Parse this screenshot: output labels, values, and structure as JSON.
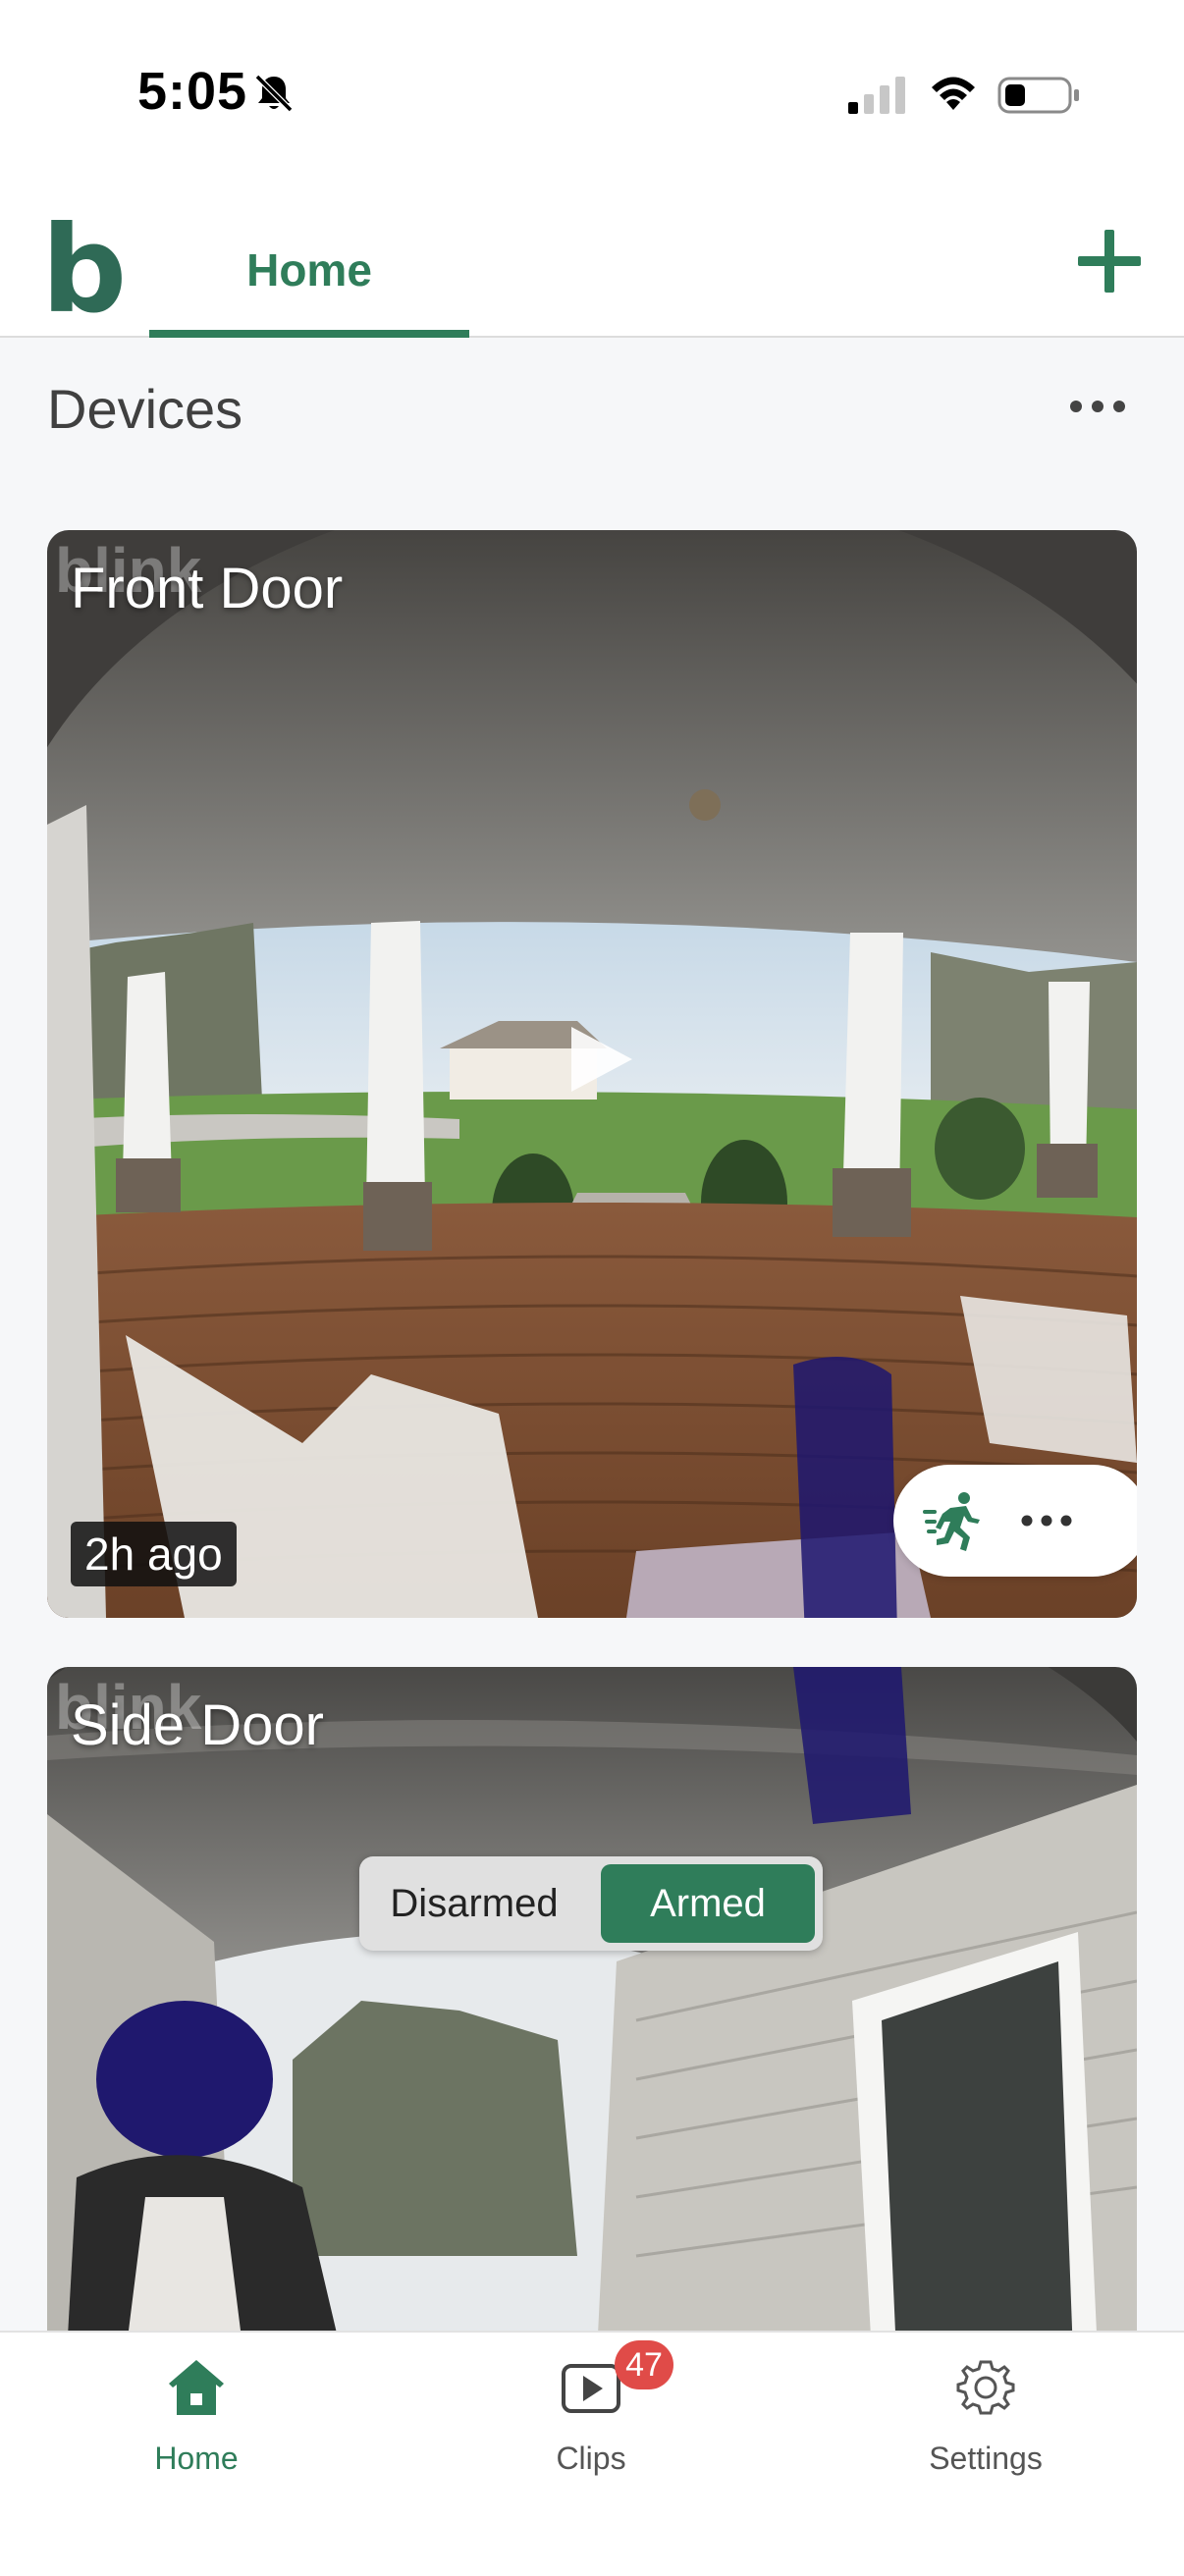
{
  "status_bar": {
    "time": "5:05",
    "icons": [
      "bell-off-icon",
      "signal-icon",
      "wifi-icon",
      "battery-icon"
    ]
  },
  "header": {
    "logo_text": "b",
    "tabs": [
      {
        "label": "Home",
        "active": true
      }
    ],
    "add_icon": "plus-icon"
  },
  "devices": {
    "title": "Devices",
    "more_icon": "ellipsis-icon"
  },
  "cameras": [
    {
      "name": "Front Door",
      "watermark": "blink",
      "last_event": "2h ago",
      "controls": [
        "motion-icon",
        "ellipsis-icon"
      ]
    },
    {
      "name": "Side Door",
      "watermark": "blink"
    }
  ],
  "arm_toggle": {
    "options": [
      "Disarmed",
      "Armed"
    ],
    "selected": "Armed"
  },
  "bottom_nav": {
    "items": [
      {
        "label": "Home",
        "icon": "home-icon",
        "active": true
      },
      {
        "label": "Clips",
        "icon": "play-box-icon",
        "badge": "47"
      },
      {
        "label": "Settings",
        "icon": "gear-icon"
      }
    ]
  },
  "colors": {
    "brand": "#2f7d5a",
    "logo": "#2f6a56",
    "badge": "#e04b48",
    "background": "#f6f7f9"
  }
}
